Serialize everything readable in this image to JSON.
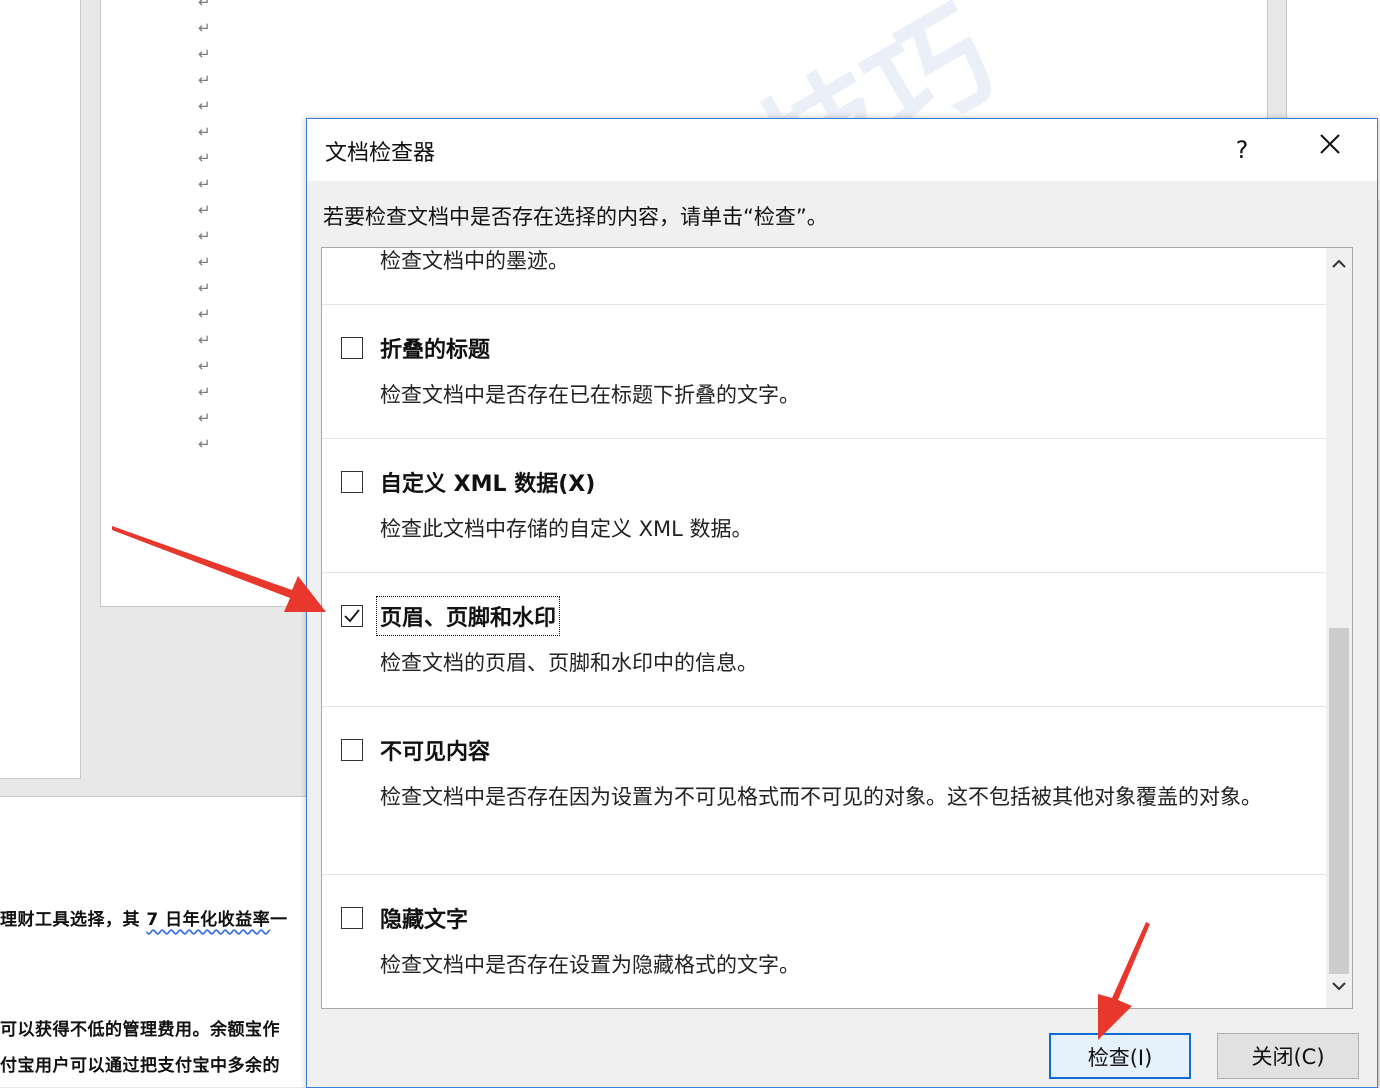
{
  "background_doc": {
    "para_mark": "↵",
    "watermark_text": "技巧",
    "lines": [
      {
        "before": "理财工具选择，其 ",
        "squiggle": "7 日年化收益率",
        "after": "一"
      },
      {
        "before": "可以获得不低的管理费用。余额宝作",
        "squiggle": "",
        "after": ""
      },
      {
        "before": "付宝用户可以通过把支付宝中多余的",
        "squiggle": "",
        "after": ""
      }
    ]
  },
  "dialog": {
    "title": "文档检查器",
    "help_label": "?",
    "instruction": "若要检查文档中是否存在选择的内容，请单击“检查”。",
    "items": [
      {
        "title": "",
        "desc": "检查文档中的墨迹。",
        "checked": false
      },
      {
        "title": "折叠的标题",
        "desc": "检查文档中是否存在已在标题下折叠的文字。",
        "checked": false
      },
      {
        "title": "自定义 XML 数据(X)",
        "desc": "检查此文档中存储的自定义 XML 数据。",
        "checked": false
      },
      {
        "title": "页眉、页脚和水印",
        "desc": "检查文档的页眉、页脚和水印中的信息。",
        "checked": true
      },
      {
        "title": "不可见内容",
        "desc": "检查文档中是否存在因为设置为不可见格式而不可见的对象。这不包括被其他对象覆盖的对象。",
        "checked": false
      },
      {
        "title": "隐藏文字",
        "desc": "检查文档中是否存在设置为隐藏格式的文字。",
        "checked": false
      }
    ],
    "buttons": {
      "inspect": "检查(I)",
      "close": "关闭(C)"
    },
    "accent_color": "#0f6ad1",
    "annotation_color": "#e8382d"
  }
}
